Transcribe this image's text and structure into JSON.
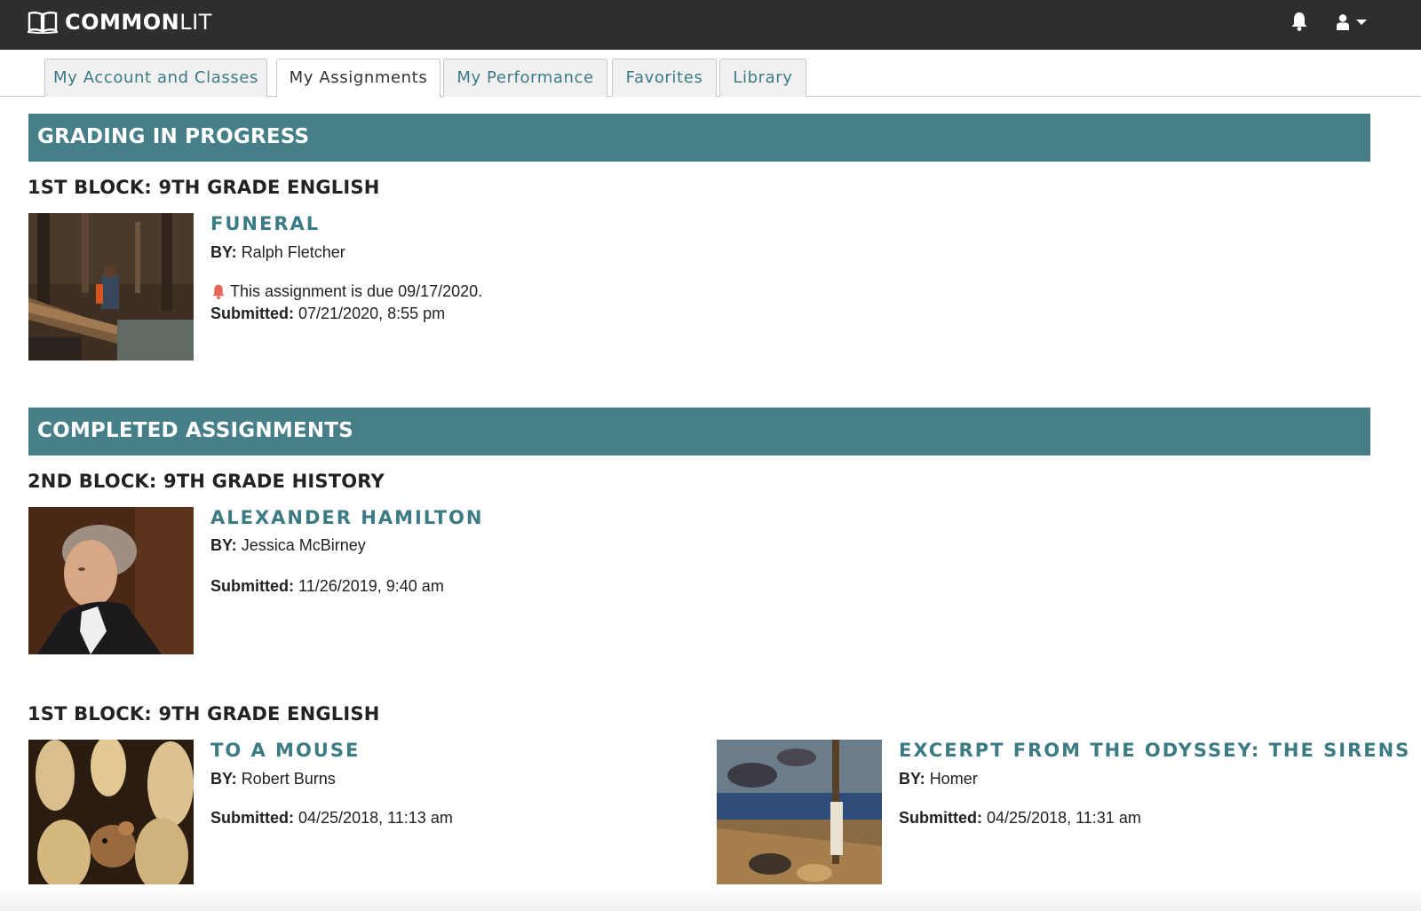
{
  "app": {
    "logo_bold": "COMMON",
    "logo_light": "LIT"
  },
  "header": {
    "notifications_icon": "bell-icon",
    "user_icon": "user-icon"
  },
  "tabs": [
    {
      "label": "My Account and Classes",
      "active": false
    },
    {
      "label": "My Assignments",
      "active": true
    },
    {
      "label": "My Performance",
      "active": false
    },
    {
      "label": "Favorites",
      "active": false
    },
    {
      "label": "Library",
      "active": false
    }
  ],
  "sections": {
    "grading": {
      "title": "GRADING IN PROGRESS",
      "class_title": "1ST BLOCK: 9TH GRADE ENGLISH",
      "assignment": {
        "title": "FUNERAL",
        "by_label": "BY:",
        "author": "Ralph Fletcher",
        "due_text": "This assignment is due 09/17/2020.",
        "submitted_label": "Submitted:",
        "submitted": "07/21/2020, 8:55 pm"
      }
    },
    "completed": {
      "title": "COMPLETED ASSIGNMENTS",
      "groups": [
        {
          "class_title": "2ND BLOCK: 9TH GRADE HISTORY",
          "assignments": [
            {
              "title": "ALEXANDER HAMILTON",
              "by_label": "BY:",
              "author": "Jessica McBirney",
              "submitted_label": "Submitted:",
              "submitted": "11/26/2019, 9:40 am"
            }
          ]
        },
        {
          "class_title": "1ST BLOCK: 9TH GRADE ENGLISH",
          "assignments": [
            {
              "title": "TO A MOUSE",
              "by_label": "BY:",
              "author": "Robert Burns",
              "submitted_label": "Submitted:",
              "submitted": "04/25/2018, 11:13 am"
            },
            {
              "title": "EXCERPT FROM THE ODYSSEY: THE SIRENS",
              "by_label": "BY:",
              "author": "Homer",
              "submitted_label": "Submitted:",
              "submitted": "04/25/2018, 11:31 am"
            }
          ]
        }
      ]
    }
  },
  "colors": {
    "topbar": "#2e2e2e",
    "accent": "#467f87",
    "link": "#3c7b84",
    "due_bell": "#e8675b"
  }
}
